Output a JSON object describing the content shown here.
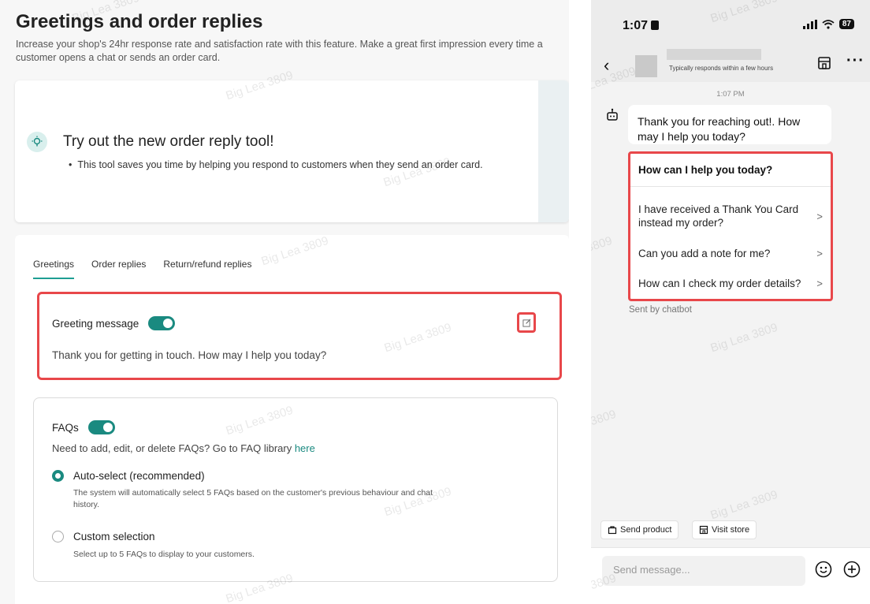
{
  "left": {
    "title": "Greetings and order replies",
    "description": "Increase your shop's 24hr response rate and satisfaction rate with this feature. Make a great first impression every time a customer opens a chat or sends an order card.",
    "promo": {
      "title": "Try out the new order reply tool!",
      "bullet": "This tool saves you time by helping you respond to customers when they send an order card."
    },
    "tabs": [
      "Greetings",
      "Order replies",
      "Return/refund replies"
    ],
    "greeting": {
      "title": "Greeting message",
      "enabled": true,
      "text": "Thank you for getting in touch. How may I help you today?"
    },
    "faqs": {
      "title": "FAQs",
      "enabled": true,
      "note": "Need to add, edit, or delete FAQs? Go to FAQ library ",
      "note_link": "here",
      "options": [
        {
          "label": "Auto-select (recommended)",
          "sub": "The system will automatically select 5 FAQs based on the customer's previous behaviour and chat history.",
          "selected": true
        },
        {
          "label": "Custom selection",
          "sub": "Select up to 5 FAQs to display to your customers.",
          "selected": false
        }
      ]
    }
  },
  "phone": {
    "time": "1:07",
    "battery": "87",
    "responds": "Typically responds within a few hours",
    "msg_time": "1:07 PM",
    "bubble": "Thank you for reaching out!. How may I help you today?",
    "faq_card": {
      "heading": "How can I help you today?",
      "items": [
        "I have received a Thank You Card instead my order?",
        "Can you add a note for me?",
        "How can I check my order details?"
      ]
    },
    "sent_by": "Sent by chatbot",
    "chips": [
      "Send product",
      "Visit store"
    ],
    "input_placeholder": "Send message...",
    "watermark": "Big Lea 3809"
  },
  "colors": {
    "accent": "#1a8a80",
    "highlight": "#e8474a"
  }
}
